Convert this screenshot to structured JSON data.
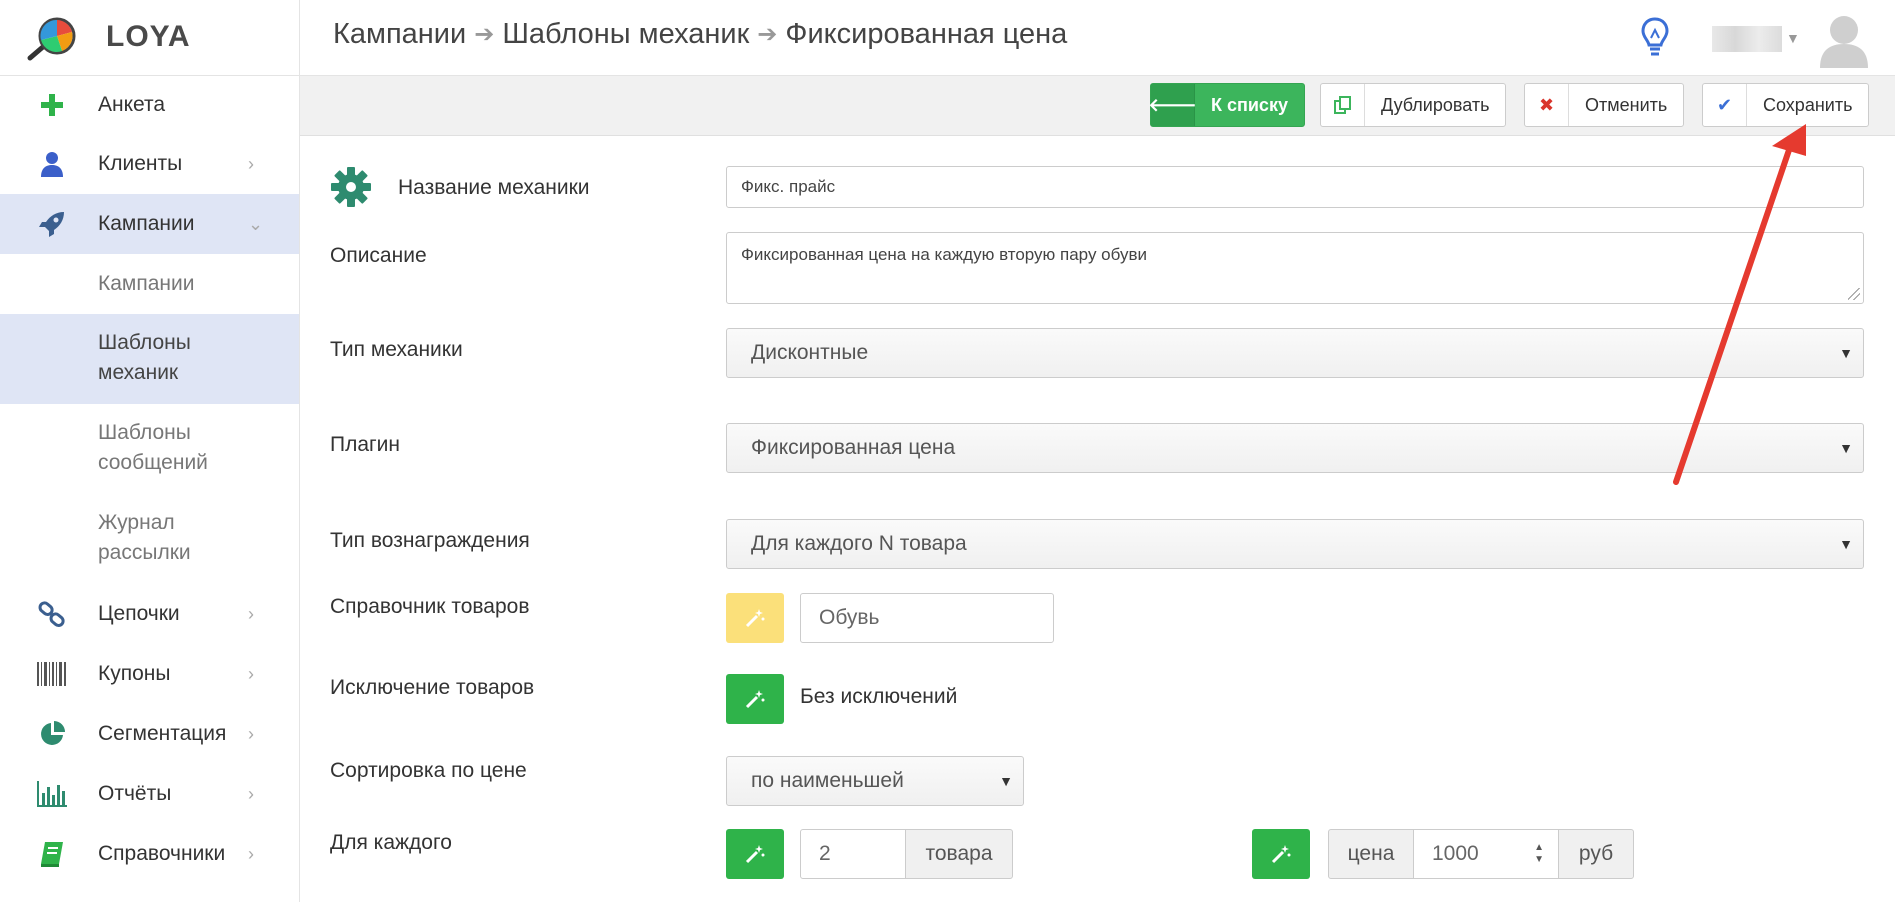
{
  "app": {
    "logo_text": "LOYA"
  },
  "breadcrumb": [
    "Кампании",
    "Шаблоны механик",
    "Фиксированная цена"
  ],
  "toolbar": {
    "back_label": "К списку",
    "duplicate_label": "Дублировать",
    "cancel_label": "Отменить",
    "save_label": "Сохранить"
  },
  "sidebar": {
    "items": [
      {
        "label": "Анкета",
        "icon": "plus-icon"
      },
      {
        "label": "Клиенты",
        "icon": "user-icon"
      },
      {
        "label": "Кампании",
        "icon": "rocket-icon"
      },
      {
        "label": "Цепочки",
        "icon": "link-icon"
      },
      {
        "label": "Купоны",
        "icon": "barcode-icon"
      },
      {
        "label": "Сегментация",
        "icon": "pie-chart-icon"
      },
      {
        "label": "Отчёты",
        "icon": "bar-chart-icon"
      },
      {
        "label": "Справочники",
        "icon": "book-icon"
      }
    ],
    "sub_items": [
      {
        "label": "Кампании"
      },
      {
        "label": "Шаблоны механик"
      },
      {
        "label": "Шаблоны сообщений"
      },
      {
        "label": "Журнал рассылки"
      }
    ]
  },
  "form": {
    "name_label": "Название механики",
    "name_value": "Фикс. прайс",
    "description_label": "Описание",
    "description_value": "Фиксированная цена на каждую вторую пару обуви",
    "mechanic_type_label": "Тип механики",
    "mechanic_type_value": "Дисконтные",
    "plugin_label": "Плагин",
    "plugin_value": "Фиксированная цена",
    "reward_type_label": "Тип вознаграждения",
    "reward_type_value": "Для каждого N товара",
    "catalog_label": "Справочник товаров",
    "catalog_value": "Обувь",
    "exclusion_label": "Исключение товаров",
    "exclusion_value": "Без исключений",
    "sort_label": "Сортировка по цене",
    "sort_value": "по наименьшей",
    "each_label": "Для каждого",
    "each_count": "2",
    "each_unit": "товара",
    "price_label": "цена",
    "price_value": "1000",
    "price_unit": "руб"
  }
}
